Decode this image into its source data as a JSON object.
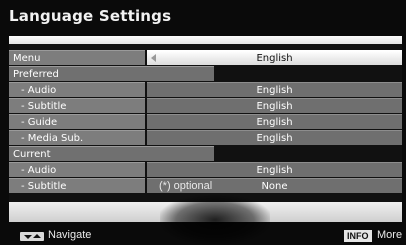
{
  "title": "Language Settings",
  "menu": {
    "label": "Menu",
    "value": "English"
  },
  "preferred": {
    "label": "Preferred",
    "items": [
      {
        "label": "- Audio",
        "value": "English"
      },
      {
        "label": "- Subtitle",
        "value": "English"
      },
      {
        "label": "- Guide",
        "value": "English"
      },
      {
        "label": "- Media Sub.",
        "value": "English"
      }
    ]
  },
  "current": {
    "label": "Current",
    "items": [
      {
        "label": "- Audio",
        "value": "English"
      },
      {
        "label": "- Subtitle",
        "value": "None"
      }
    ],
    "note": "(*) optional"
  },
  "footer": {
    "navigate_label": "Navigate",
    "info_key": "INFO",
    "info_label": "More"
  }
}
